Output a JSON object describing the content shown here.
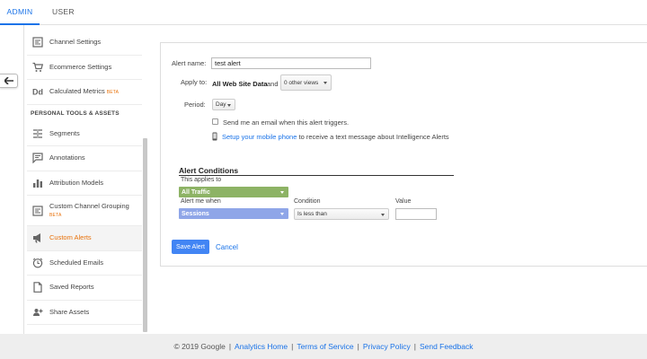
{
  "tabs": {
    "admin": "ADMIN",
    "user": "USER"
  },
  "sidebar": {
    "items_top": [
      {
        "label": "Channel Settings",
        "icon": "channel-settings-icon"
      },
      {
        "label": "Ecommerce Settings",
        "icon": "cart-icon"
      },
      {
        "label": "Calculated Metrics",
        "icon": "dd-icon",
        "badge": "BETA"
      }
    ],
    "section_title": "PERSONAL TOOLS & ASSETS",
    "items_bottom": [
      {
        "label": "Segments",
        "icon": "segments-icon"
      },
      {
        "label": "Annotations",
        "icon": "annotations-icon"
      },
      {
        "label": "Attribution Models",
        "icon": "bar-chart-icon"
      },
      {
        "label": "Custom Channel Grouping",
        "icon": "channel-grouping-icon",
        "badge": "BETA"
      },
      {
        "label": "Custom Alerts",
        "icon": "megaphone-icon",
        "active": true
      },
      {
        "label": "Scheduled Emails",
        "icon": "clock-icon"
      },
      {
        "label": "Saved Reports",
        "icon": "document-icon"
      },
      {
        "label": "Share Assets",
        "icon": "share-icon"
      }
    ]
  },
  "form": {
    "alert_name_label": "Alert name:",
    "alert_name_value": "test alert",
    "apply_to_label": "Apply to:",
    "apply_to_value": "All Web Site Data",
    "apply_to_and": "and",
    "other_views": "0 other views",
    "period_label": "Period:",
    "period_value": "Day",
    "email_checkbox_label": "Send me an email when this alert triggers.",
    "mobile_link": "Setup your mobile phone",
    "mobile_text": "to receive a text message about Intelligence Alerts"
  },
  "conditions": {
    "title": "Alert Conditions",
    "applies_to_label": "This applies to",
    "applies_to_value": "All Traffic",
    "alert_when_label": "Alert me when",
    "alert_when_value": "Sessions",
    "condition_label": "Condition",
    "condition_value": "Is less than",
    "value_label": "Value",
    "value_value": ""
  },
  "actions": {
    "save": "Save Alert",
    "cancel": "Cancel"
  },
  "footer": {
    "copyright": "© 2019 Google",
    "links": [
      "Analytics Home",
      "Terms of Service",
      "Privacy Policy",
      "Send Feedback"
    ]
  },
  "colors": {
    "accent": "#1a73e8",
    "active": "#e8710a",
    "traffic": "#8db365",
    "sessions": "#8fa6e8",
    "save": "#4285f4"
  }
}
